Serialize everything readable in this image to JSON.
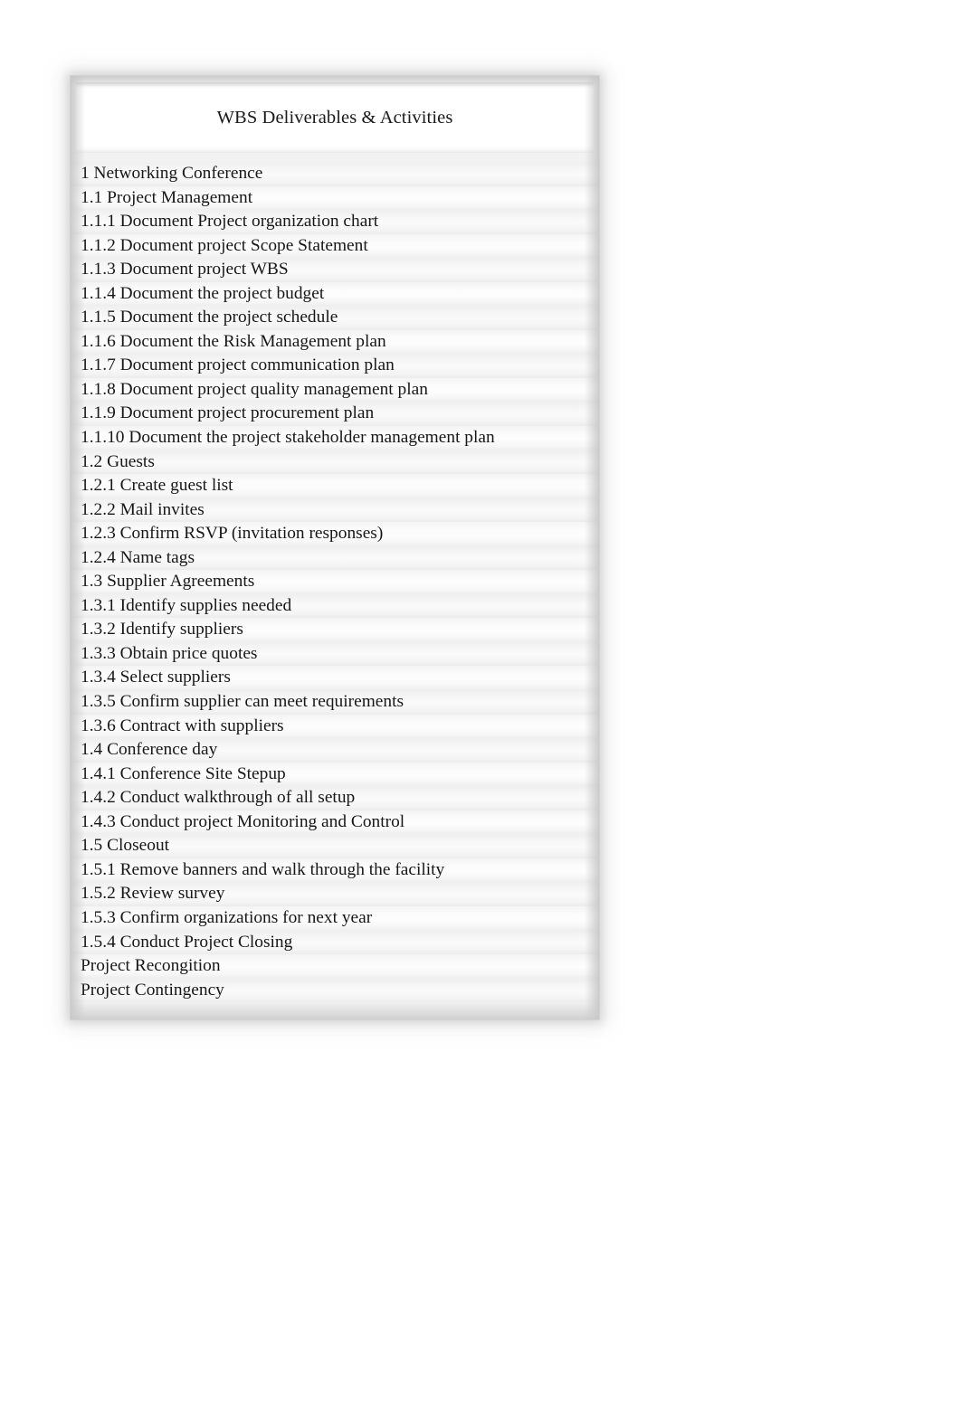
{
  "document": {
    "header": {
      "title": "WBS Deliverables & Activities"
    },
    "rows": [
      {
        "text": "1 Networking Conference"
      },
      {
        "text": "1.1 Project Management"
      },
      {
        "text": "1.1.1 Document Project organization chart"
      },
      {
        "text": "1.1.2 Document project Scope Statement"
      },
      {
        "text": "1.1.3 Document project WBS"
      },
      {
        "text": "1.1.4 Document the project budget"
      },
      {
        "text": "1.1.5 Document the project schedule"
      },
      {
        "text": "1.1.6 Document the Risk Management plan"
      },
      {
        "text": "1.1.7 Document project communication plan"
      },
      {
        "text": "1.1.8 Document project quality management plan"
      },
      {
        "text": "1.1.9 Document project procurement plan"
      },
      {
        "text": "1.1.10 Document the project stakeholder management plan"
      },
      {
        "text": "1.2 Guests"
      },
      {
        "text": "1.2.1 Create guest list"
      },
      {
        "text": "1.2.2 Mail invites"
      },
      {
        "text": "1.2.3 Confirm RSVP (invitation responses)"
      },
      {
        "text": "1.2.4 Name tags"
      },
      {
        "text": "1.3 Supplier Agreements"
      },
      {
        "text": "1.3.1 Identify supplies needed"
      },
      {
        "text": "1.3.2 Identify suppliers"
      },
      {
        "text": "1.3.3 Obtain price quotes"
      },
      {
        "text": "1.3.4 Select suppliers"
      },
      {
        "text": "1.3.5 Confirm supplier can meet requirements"
      },
      {
        "text": "1.3.6 Contract with suppliers"
      },
      {
        "text": "1.4 Conference day"
      },
      {
        "text": "1.4.1 Conference Site Stepup"
      },
      {
        "text": "1.4.2 Conduct walkthrough of all setup"
      },
      {
        "text": "1.4.3 Conduct project Monitoring and Control"
      },
      {
        "text": "1.5 Closeout"
      },
      {
        "text": "1.5.1 Remove banners and walk through the facility"
      },
      {
        "text": "1.5.2 Review survey"
      },
      {
        "text": "1.5.3 Confirm organizations for next year"
      },
      {
        "text": "1.5.4 Conduct Project Closing"
      },
      {
        "text": "Project Recongition"
      },
      {
        "text": "Project Contingency"
      }
    ],
    "colors": {
      "page_background": "#ffffff",
      "sheet_background": "#f2f2f2",
      "header_background": "#ffffff",
      "text": "#171717",
      "row_shade_light": "#fdfdfd",
      "row_shade_dark": "#ececec"
    }
  }
}
